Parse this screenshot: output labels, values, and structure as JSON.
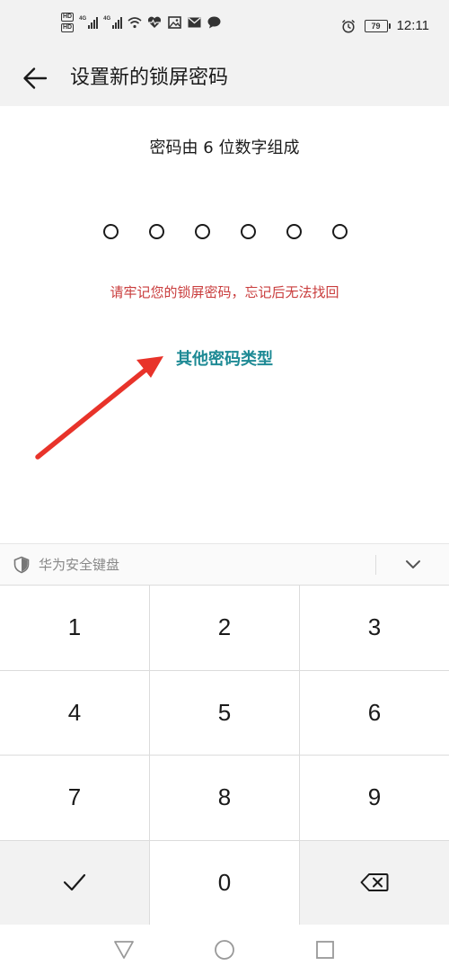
{
  "status_bar": {
    "hd_labels": [
      "HD",
      "HD"
    ],
    "network_labels": [
      "4G",
      "4G"
    ],
    "battery_level": "79",
    "time": "12:11",
    "left_icons": [
      "wifi-icon",
      "health-icon",
      "gallery-icon",
      "mail-icon",
      "chat-icon"
    ],
    "right_icons": [
      "alarm-icon"
    ]
  },
  "header": {
    "title": "设置新的锁屏密码",
    "back_icon": "arrow-left-icon"
  },
  "main": {
    "hint": "密码由 6 位数字组成",
    "pin_length": 6,
    "entered_digits": 0,
    "warning": "请牢记您的锁屏密码，忘记后无法找回",
    "other_types_link": "其他密码类型"
  },
  "colors": {
    "warning": "#c93c3c",
    "link": "#1e8a95",
    "arrow": "#e8332a",
    "header_bg": "#f2f2f2"
  },
  "keyboard": {
    "title": "华为安全键盘",
    "shield_icon": "shield-icon",
    "collapse_icon": "chevron-down-icon",
    "keys": [
      "1",
      "2",
      "3",
      "4",
      "5",
      "6",
      "7",
      "8",
      "9"
    ],
    "zero_key": "0",
    "confirm_icon": "checkmark-icon",
    "delete_icon": "backspace-icon"
  },
  "nav_bar": {
    "icons": [
      "back-triangle-icon",
      "home-circle-icon",
      "recents-square-icon"
    ]
  }
}
